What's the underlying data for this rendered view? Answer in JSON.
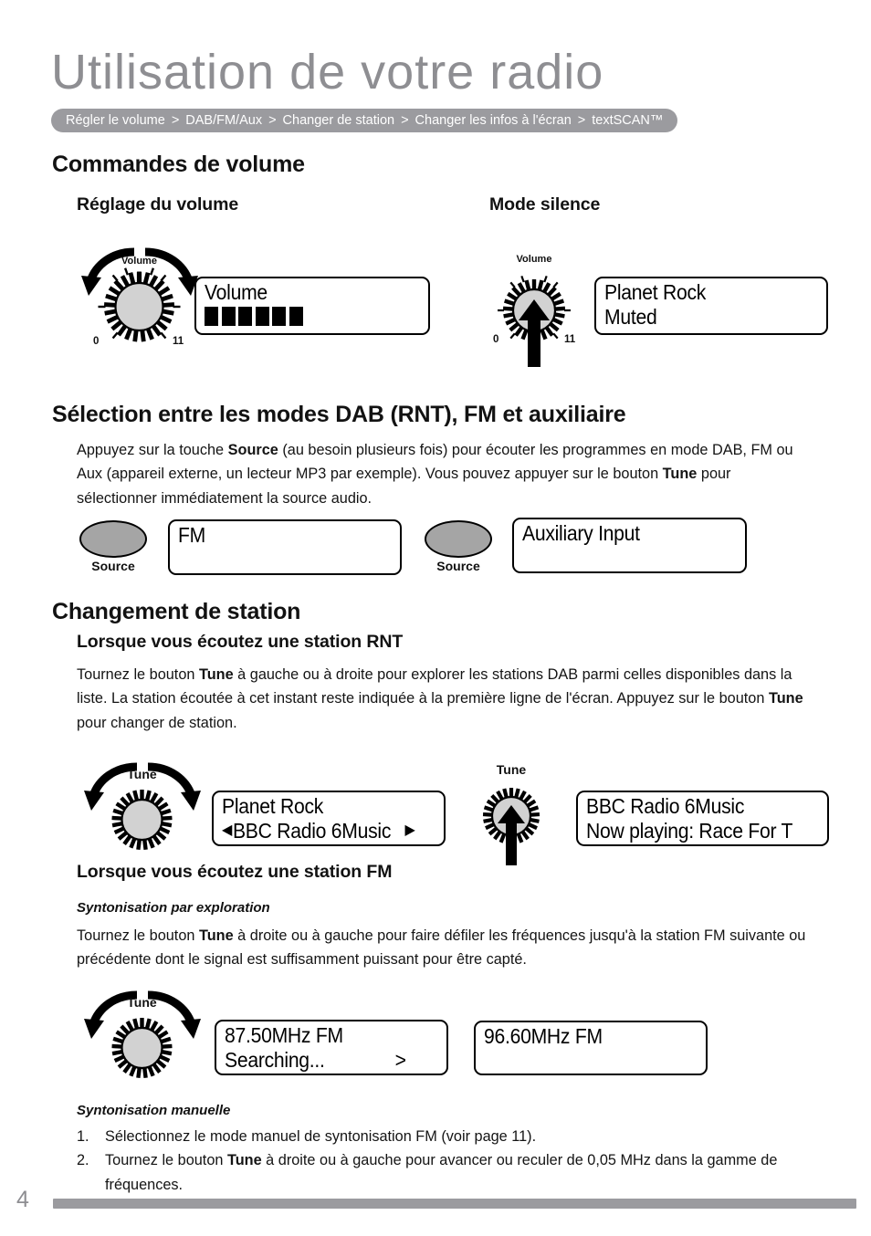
{
  "header": {
    "title": "Utilisation de votre radio",
    "breadcrumb": {
      "separator": ">",
      "items": [
        "Régler le volume",
        "DAB/FM/Aux",
        "Changer de station",
        "Changer les infos à l'écran",
        "textSCAN™"
      ]
    },
    "title_color": "#8e8e92",
    "breadcrumb_bg": "#9b9b9f"
  },
  "volume_section": {
    "heading": "Commandes de volume",
    "adjust": {
      "subheading": "Réglage du volume",
      "knob": {
        "label": "Volume",
        "min": "0",
        "max": "11",
        "action": "rotate"
      },
      "display": {
        "line1": "Volume",
        "bars_filled": 6
      }
    },
    "mute": {
      "subheading": "Mode silence",
      "knob": {
        "label": "Volume",
        "min": "0",
        "max": "11",
        "action": "press"
      },
      "display": {
        "line1": "Planet Rock",
        "line2": "Muted"
      }
    }
  },
  "source_section": {
    "heading": "Sélection entre les modes DAB (RNT), FM et auxiliaire",
    "paragraph": {
      "part1": "Appuyez sur la touche ",
      "bold1": "Source",
      "part2": " (au besoin plusieurs fois) pour écouter les programmes en mode DAB, FM ou Aux (appareil externe, un lecteur MP3 par exemple). Vous pouvez appuyer sur le bouton ",
      "bold2": "Tune",
      "part3": " pour sélectionner immédiatement la source audio."
    },
    "button_label": "Source",
    "display_fm": {
      "line1": "FM"
    },
    "display_aux": {
      "line1": "Auxiliary Input"
    }
  },
  "station_section": {
    "heading": "Changement de station",
    "dab": {
      "subheading": "Lorsque vous écoutez une station RNT",
      "paragraph": {
        "part1": "Tournez le bouton ",
        "bold1": "Tune",
        "part2": " à gauche ou à droite pour explorer les stations DAB parmi celles disponibles dans la liste. La station écoutée à cet instant reste indiquée à la première ligne de l'écran. Appuyez sur le bouton ",
        "bold2": "Tune",
        "part3": " pour changer de station."
      },
      "knob_rotate": {
        "label": "Tune",
        "action": "rotate"
      },
      "display_rotate": {
        "line1": "Planet Rock",
        "line2_left_arrow": "◀",
        "line2": "BBC Radio 6Music",
        "line2_right_arrow": "▶"
      },
      "knob_press": {
        "label": "Tune",
        "action": "press"
      },
      "display_press": {
        "line1": "BBC Radio 6Music",
        "line2": "Now playing: Race For T"
      }
    },
    "fm": {
      "subheading": "Lorsque vous écoutez une station FM",
      "scan": {
        "title": "Syntonisation par exploration",
        "paragraph": {
          "part1": "Tournez le bouton ",
          "bold1": "Tune",
          "part2": " à droite ou à gauche pour faire défiler les fréquences jusqu'à la station FM suivante ou précédente dont le signal est suffisamment puissant pour être capté."
        },
        "knob": {
          "label": "Tune",
          "action": "rotate"
        },
        "display_searching": {
          "line1": "87.50MHz   FM",
          "line2": "Searching...",
          "line2_arrow": ">"
        },
        "display_found": {
          "line1": "96.60MHz   FM"
        }
      },
      "manual": {
        "title": "Syntonisation manuelle",
        "items": [
          {
            "num": "1.",
            "part1": "Sélectionnez le mode manuel de syntonisation FM (voir page 11).",
            "bold1": "",
            "part2": ""
          },
          {
            "num": "2.",
            "part1": "Tournez le bouton ",
            "bold1": "Tune",
            "part2": " à droite ou à gauche pour avancer ou reculer de 0,05 MHz dans la gamme de fréquences."
          }
        ]
      }
    }
  },
  "footer": {
    "page_number": "4",
    "bar_color": "#9b9b9f"
  }
}
